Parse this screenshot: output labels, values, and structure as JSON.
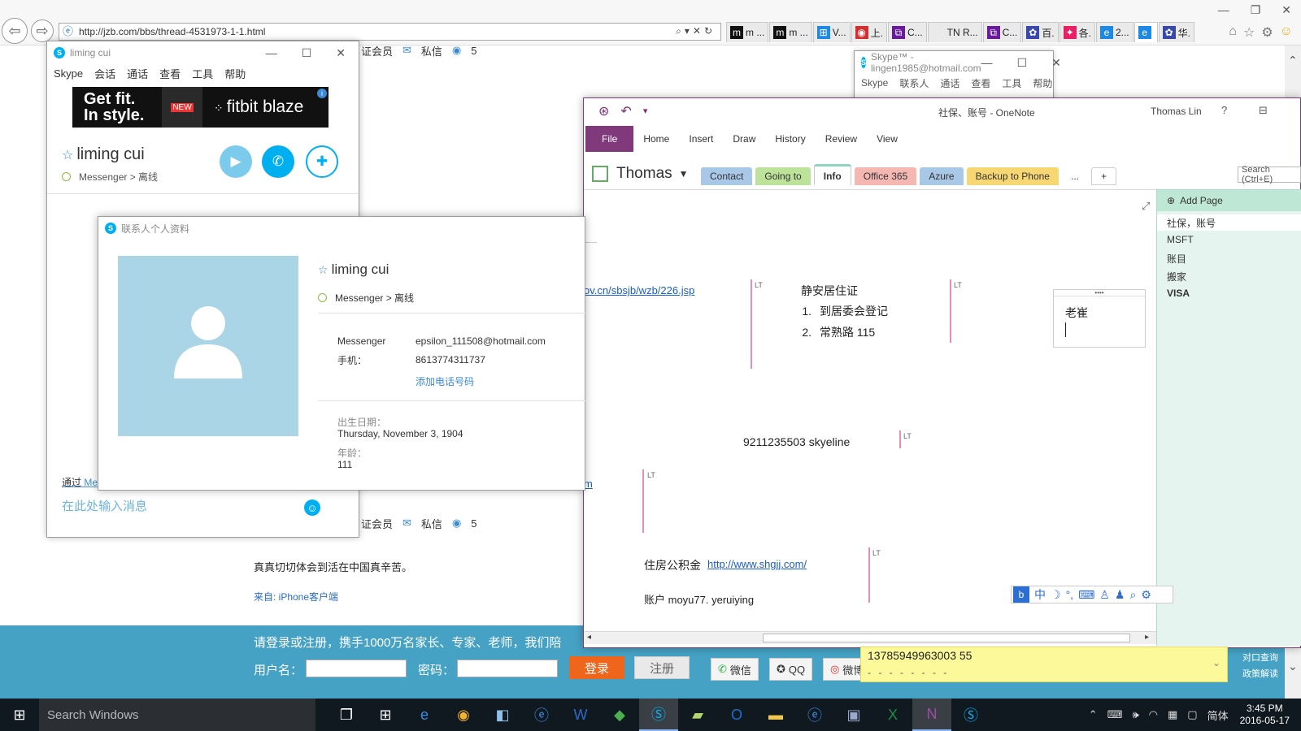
{
  "browser": {
    "url": "http://jzb.com/bbs/thread-4531973-1-1.html",
    "tabs": [
      {
        "label": "m ...",
        "color": "#111111",
        "glyph": "m"
      },
      {
        "label": "m ...",
        "color": "#111111",
        "glyph": "m"
      },
      {
        "label": "V...",
        "color": "#1e88e5",
        "glyph": "⊞"
      },
      {
        "label": "上.",
        "color": "#d32f2f",
        "glyph": "◉"
      },
      {
        "label": "C...",
        "color": "#6a1b9a",
        "glyph": "⧉"
      },
      {
        "label": "TN R...",
        "color": "#eaeaea",
        "glyph": ""
      },
      {
        "label": "C...",
        "color": "#6a1b9a",
        "glyph": "⧉"
      },
      {
        "label": "百.",
        "color": "#3949ab",
        "glyph": "✿"
      },
      {
        "label": "各.",
        "color": "#e91e63",
        "glyph": "✦"
      },
      {
        "label": "2...",
        "color": "#1e88e5",
        "glyph": "e"
      },
      {
        "label": "",
        "color": "#1e88e5",
        "glyph": "e",
        "active": true
      },
      {
        "label": "华.",
        "color": "#3949ab",
        "glyph": "✿"
      }
    ]
  },
  "forum": {
    "strip_member": "证会员",
    "strip_pm": "私信",
    "strip_count": "5",
    "post_text": "真真切切体会到活在中国真辛苦。",
    "post_source": "来自: iPhone客户端",
    "dock_promo": "请登录或注册，携手1000万名家长、专家、老师，我们陪",
    "username_label": "用户名：",
    "password_label": "密码：",
    "login_label": "登录",
    "register_label": "注册",
    "wechat_label": "微信",
    "qq_label": "QQ",
    "weibo_label": "微博",
    "right_link_1": "对口查询",
    "right_link_2": "政策解读"
  },
  "skype_chat": {
    "window_title": "liming cui",
    "menu": [
      "Skype",
      "会话",
      "通话",
      "查看",
      "工具",
      "帮助"
    ],
    "ad_left_line1": "Get fit.",
    "ad_left_line2": "In style.",
    "ad_badge": "NEW",
    "ad_right": "fitbit blaze",
    "contact_name": "liming cui",
    "contact_status": "Messenger > 离线",
    "via_label": "通过",
    "via_link": "Me",
    "input_placeholder": "在此处输入消息"
  },
  "profile": {
    "window_title": "联系人个人资料",
    "name": "liming cui",
    "status": "Messenger > 离线",
    "messenger_label": "Messenger",
    "messenger_value": "epsilon_111508@hotmail.com",
    "phone_label": "手机：",
    "phone_value": "8613774311737",
    "add_phone_label": "添加电话号码",
    "birthday_label": "出生日期：",
    "birthday_value": "Thursday, November 3, 1904",
    "age_label": "年龄：",
    "age_value": "111"
  },
  "skype_main": {
    "window_title": "Skype™ - lingen1985@hotmail.com",
    "menu": [
      "Skype",
      "联系人",
      "通话",
      "查看",
      "工具",
      "帮助"
    ]
  },
  "onenote": {
    "title": "社保、账号 - OneNote",
    "user": "Thomas Lin",
    "help": "?",
    "ribbon_tabs": [
      "File",
      "Home",
      "Insert",
      "Draw",
      "History",
      "Review",
      "View"
    ],
    "notebook": "Thomas",
    "sections": [
      {
        "label": "Contact",
        "color": "#a9c8e8"
      },
      {
        "label": "Going to",
        "color": "#bde29a"
      },
      {
        "label": "Info",
        "color": "#8fd3bf",
        "active": true
      },
      {
        "label": "Office 365",
        "color": "#f5b7b1"
      },
      {
        "label": "Azure",
        "color": "#a9c8e8"
      },
      {
        "label": "Backup to Phone",
        "color": "#f7d774"
      },
      {
        "label": "...",
        "color": "#ffffff"
      }
    ],
    "search_placeholder": "Search (Ctrl+E)",
    "add_page": "Add Page",
    "pages": [
      {
        "label": "社保，账号",
        "selected": true
      },
      {
        "label": "MSFT"
      },
      {
        "label": "账目"
      },
      {
        "label": "搬家"
      },
      {
        "label": "VISA",
        "bold": true
      }
    ],
    "link_1": "ov.cn/sbsjb/wzb/226.jsp",
    "heading_1": "静安居住证",
    "list_1": [
      "到居委会登记",
      "常熟路 115"
    ],
    "container_text": "老崔",
    "line_skyline": "9211235503 skyeline",
    "link_m": "m",
    "housing_label": "住房公积金",
    "housing_link": "http://www.shgjj.com/",
    "account_line": "账户 moyu77. yeruiying",
    "lt_tag": "LT"
  },
  "sticky": {
    "text": "13785949963003 55",
    "dots": "- - - - - - - -"
  },
  "taskbar": {
    "search_placeholder": "Search Windows",
    "ime_label": "简体",
    "time": "3:45 PM",
    "date": "2016-05-17"
  }
}
